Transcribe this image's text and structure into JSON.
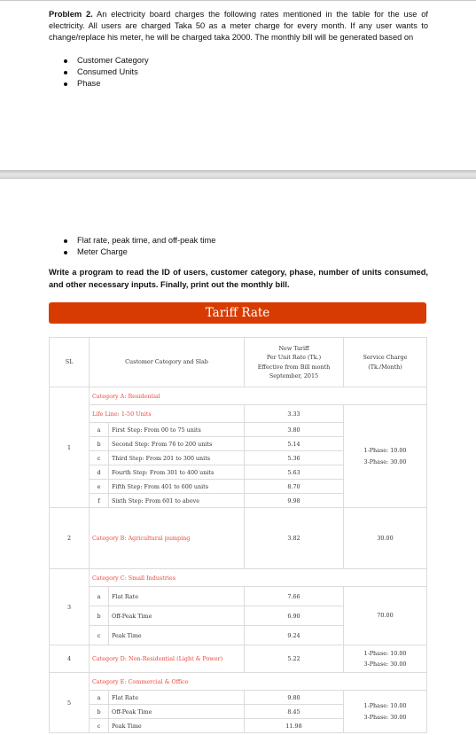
{
  "document": {
    "problem_label": "Problem 2.",
    "intro": " An electricity board charges the following rates mentioned in the table for the use of electricity. All users are charged Taka 50 as a meter charge for every month. If any user wants to change/replace his meter, he will be charged taka 2000. The monthly bill will be generated based on",
    "bullets_page1": [
      "Customer Category",
      "Consumed Units",
      "Phase"
    ],
    "bullets_page2": [
      "Flat rate, peak time, and off-peak time",
      "Meter Charge"
    ],
    "task": "Write a program to read the ID of users, customer category, phase, number of units consumed, and other necessary inputs. Finally, print out the monthly bill."
  },
  "tariff": {
    "banner_title": "Tariff Rate",
    "banner_color": "#D83B01",
    "category_color": "#E8473D",
    "headers": {
      "sl": "SL",
      "category": "Customer Category and Slab",
      "rate_lines": [
        "New Tariff",
        "Per Unit Rate (Tk.)",
        "Effective from Bill month",
        "September, 2015"
      ],
      "service_lines": [
        "Service Charge",
        "(Tk./Month)"
      ]
    },
    "rows": [
      {
        "sl": "1",
        "category": "Category A: Residential",
        "lifeline": {
          "label": "Life Line: 1-50 Units",
          "rate": "3.33"
        },
        "slabs": [
          {
            "letter": "a",
            "label": "First Step: From 00 to 75 units",
            "rate": "3.80"
          },
          {
            "letter": "b",
            "label": "Second Step: From 76 to 200 units",
            "rate": "5.14"
          },
          {
            "letter": "c",
            "label": "Third Step: From 201 to 300 units",
            "rate": "5.36"
          },
          {
            "letter": "d",
            "label": "Fourth Step: From 301 to 400 units",
            "rate": "5.63"
          },
          {
            "letter": "e",
            "label": "Fifth Step: From 401 to 600 units",
            "rate": "8.70"
          },
          {
            "letter": "f",
            "label": "Sixth Step: From 601 to above",
            "rate": "9.98"
          }
        ],
        "service": [
          "1-Phase: 10.00",
          "3-Phase: 30.00"
        ]
      },
      {
        "sl": "2",
        "category": "Category B: Agricultural pumping",
        "rate": "3.82",
        "service": [
          "30.00"
        ]
      },
      {
        "sl": "3",
        "category": "Category C: Small Industries",
        "slabs": [
          {
            "letter": "a",
            "label": "Flat Rate",
            "rate": "7.66"
          },
          {
            "letter": "b",
            "label": "Off-Peak Time",
            "rate": "6.90"
          },
          {
            "letter": "c",
            "label": "Peak Time",
            "rate": "9.24"
          }
        ],
        "service": [
          "70.00"
        ]
      },
      {
        "sl": "4",
        "category": "Category D: Non-Residential (Light & Power)",
        "rate": "5.22",
        "service": [
          "1-Phase: 10.00",
          "3-Phase: 30.00"
        ]
      },
      {
        "sl": "5",
        "category": "Category E: Commercial & Office",
        "slabs": [
          {
            "letter": "a",
            "label": "Flat Rate",
            "rate": "9.80"
          },
          {
            "letter": "b",
            "label": "Off-Peak Time",
            "rate": "8.45"
          },
          {
            "letter": "c",
            "label": "Peak Time",
            "rate": "11.98"
          }
        ],
        "service": [
          "1-Phase: 10.00",
          "3-Phase: 30.00"
        ]
      }
    ]
  }
}
